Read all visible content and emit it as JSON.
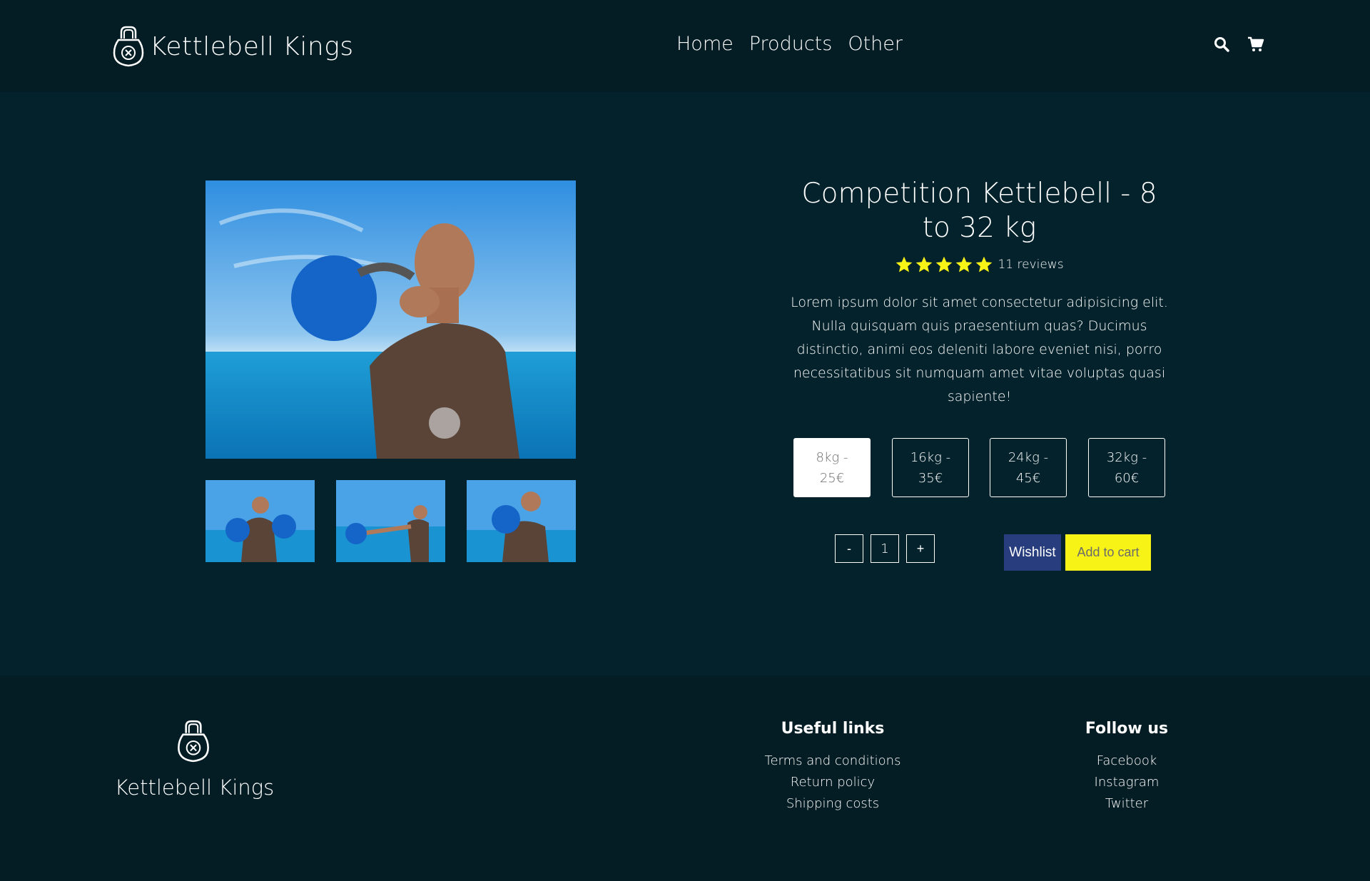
{
  "header": {
    "brand": "Kettlebell Kings",
    "nav": [
      "Home",
      "Products",
      "Other"
    ],
    "icons": [
      "search-icon",
      "cart-icon"
    ]
  },
  "product": {
    "title": "Competition Kettlebell - 8 to 32 kg",
    "rating": 5,
    "reviews": "11 reviews",
    "description": "Lorem ipsum dolor sit amet consectetur adipisicing elit. Nulla quisquam quis praesentium quas? Ducimus distinctio, animi eos deleniti labore eveniet nisi, porro necessitatibus sit numquam amet vitae voluptas quasi sapiente!",
    "sizes": [
      "8kg - 25€",
      "16kg - 35€",
      "24kg - 45€",
      "32kg - 60€"
    ],
    "selected_size": "8kg - 25€",
    "quantity": {
      "minus": "-",
      "value": "1",
      "plus": "+"
    },
    "wishlist_label": "Wishlist",
    "add_to_cart_label": "Add to cart"
  },
  "footer": {
    "brand": "Kettlebell Kings",
    "useful_links": {
      "title": "Useful links",
      "links": [
        "Terms and conditions",
        "Return policy",
        "Shipping costs"
      ]
    },
    "follow_us": {
      "title": "Follow us",
      "links": [
        "Facebook",
        "Instagram",
        "Twitter"
      ]
    }
  },
  "colors": {
    "background": "#03222b",
    "header_footer": "#041d24",
    "star": "#f7f316",
    "wishlist": "#273d7d",
    "cart": "#f7f316"
  }
}
